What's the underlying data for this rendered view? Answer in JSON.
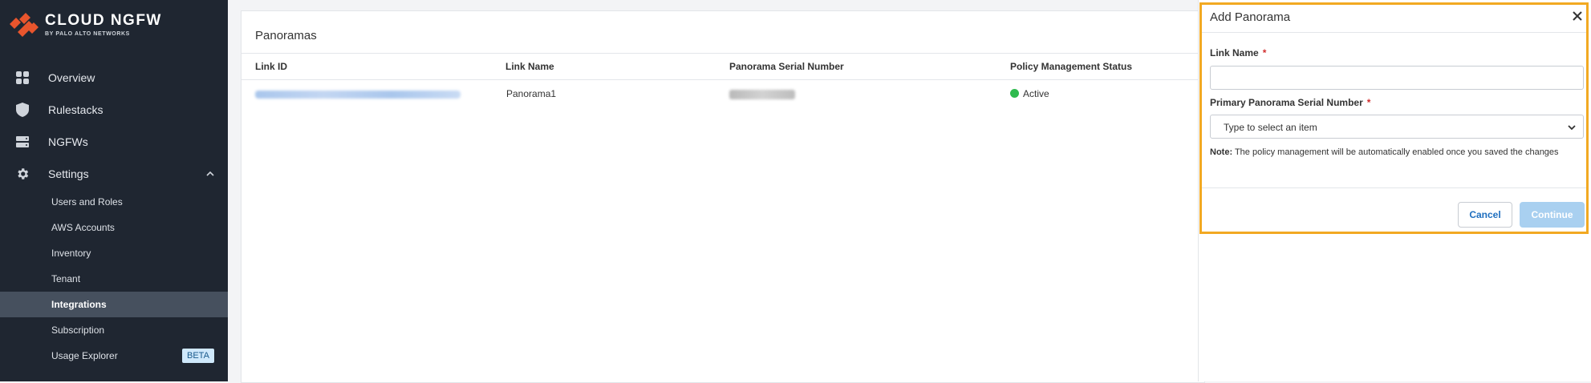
{
  "brand": {
    "title": "CLOUD NGFW",
    "subtitle": "BY PALO ALTO NETWORKS",
    "accent_color": "#e8552d"
  },
  "sidebar": {
    "items": [
      {
        "label": "Overview",
        "icon": "dashboard-grid-icon"
      },
      {
        "label": "Rulestacks",
        "icon": "shield-icon"
      },
      {
        "label": "NGFWs",
        "icon": "server-icon"
      },
      {
        "label": "Settings",
        "icon": "gear-icon",
        "expanded": true
      }
    ],
    "settings_children": [
      {
        "label": "Users and Roles"
      },
      {
        "label": "AWS Accounts"
      },
      {
        "label": "Inventory"
      },
      {
        "label": "Tenant"
      },
      {
        "label": "Integrations",
        "active": true
      },
      {
        "label": "Subscription"
      },
      {
        "label": "Usage Explorer",
        "badge": "BETA"
      }
    ]
  },
  "main": {
    "title": "Panoramas",
    "table": {
      "columns": [
        "Link ID",
        "Link Name",
        "Panorama Serial Number",
        "Policy Management Status"
      ],
      "rows": [
        {
          "link_name": "Panorama1",
          "status": "Active",
          "status_color": "#2fba4e"
        }
      ]
    }
  },
  "dialog": {
    "title": "Add Panorama",
    "link_name_label": "Link Name",
    "link_name_value": "",
    "serial_label": "Primary Panorama Serial Number",
    "serial_placeholder": "Type to select an item",
    "required_mark": "*",
    "note_prefix": "Note:",
    "note_text": " The policy management will be automatically enabled once you saved the changes",
    "cancel_label": "Cancel",
    "continue_label": "Continue",
    "highlight_color": "#f2a922"
  }
}
